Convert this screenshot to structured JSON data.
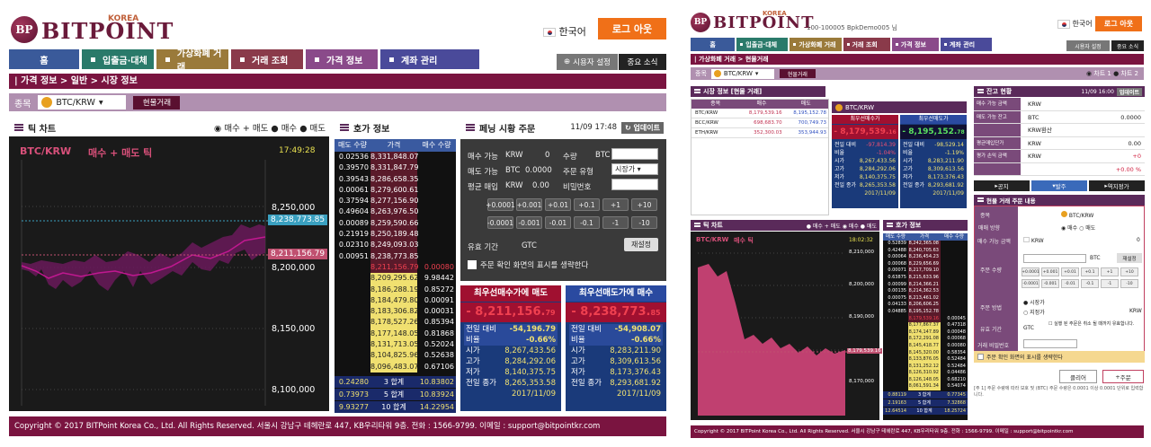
{
  "brand": {
    "name": "BITPOINT",
    "sub": "KOREA",
    "mark": "BP"
  },
  "left": {
    "lang": "한국어",
    "logout": "로그 아웃",
    "menus": [
      "홈",
      "입출금·대체",
      "가상화폐 거래",
      "거래 조회",
      "가격 정보",
      "계좌 관리"
    ],
    "prefs": "시용자 설정",
    "notice": "중요 소식",
    "breadcrumb": "가격 정보  >  일반  >  시장 정보",
    "symbol_label": "종목",
    "symbol": "BTC/KRW",
    "spot_btn": "현물거래",
    "tick": {
      "title": "틱 차트",
      "radios": [
        "매수 + 매도",
        "매수",
        "매도"
      ],
      "pair": "BTC/KRW",
      "mode": "매수 + 매도 틱",
      "time": "17:49:28",
      "axis": [
        "8,250,000",
        "8,200,000",
        "8,150,000",
        "8,100,000"
      ],
      "ask_tag": "8,238,773.85",
      "bid_tag": "8,211,156.79"
    },
    "orderbook": {
      "title": "호가 정보",
      "headers": [
        "매도 수량",
        "가격",
        "매수 수량"
      ],
      "asks": [
        [
          "0.02536",
          "8,331,848.07"
        ],
        [
          "0.39570",
          "8,331,847.79"
        ],
        [
          "0.39543",
          "8,286,658.35"
        ],
        [
          "0.00061",
          "8,279,600.61"
        ],
        [
          "0.37594",
          "8,277,156.90"
        ],
        [
          "0.49604",
          "8,263,976.50"
        ],
        [
          "0.00089",
          "8,259,590.66"
        ],
        [
          "0.21919",
          "8,250,189.48"
        ],
        [
          "0.02310",
          "8,249,093.03"
        ],
        [
          "0.00951",
          "8,238,773.85"
        ]
      ],
      "bids": [
        [
          "8,211,156.79",
          "0.00080"
        ],
        [
          "8,209,295.62",
          "9.98442"
        ],
        [
          "8,186,288.19",
          "0.85272"
        ],
        [
          "8,184,479.80",
          "0.00091"
        ],
        [
          "8,183,306.82",
          "0.00031"
        ],
        [
          "8,178,527.26",
          "0.85394"
        ],
        [
          "8,177,148.05",
          "0.81868"
        ],
        [
          "8,131,713.05",
          "0.52024"
        ],
        [
          "8,104,825.96",
          "0.52638"
        ],
        [
          "8,096,483.07",
          "0.67106"
        ]
      ],
      "totals": [
        [
          "0.24280",
          "3 합계",
          "10.83802"
        ],
        [
          "0.73973",
          "5 합계",
          "10.83924"
        ],
        [
          "9.93277",
          "10 합계",
          "14.22954"
        ]
      ]
    },
    "order": {
      "title": "페닝 시황 주문",
      "time": "11/09 17:48",
      "update": "업데이트",
      "avail_krw_l": "매수 가능",
      "avail_krw_c": "KRW",
      "avail_krw_v": "0",
      "avail_btc_l": "매도 가능",
      "avail_btc_c": "BTC",
      "avail_btc_v": "0.0000",
      "avg_l": "평균 매입",
      "avg_c": "KRW",
      "avg_v": "0.00",
      "qty_l": "수량",
      "qty_c": "BTC",
      "type_l": "주문 유형",
      "type_v": "시장가",
      "pw_l": "비밀번호",
      "steps1": [
        "+0.0001",
        "+0.001",
        "+0.01",
        "+0.1",
        "+1",
        "+10"
      ],
      "steps2": [
        "-0.0001",
        "-0.001",
        "-0.01",
        "-0.1",
        "-1",
        "-10"
      ],
      "valid_l": "유효 기간",
      "valid_v": "GTC",
      "reset": "재설정",
      "skip": "주문 확인 화면의 표시를 생략한다"
    },
    "best_bid": {
      "title": "최우선매수가에 매도",
      "price": "- 8,211,156.",
      "frac": "79",
      "cmp_l": "전일 대비",
      "cmp_v": "-54,196.79",
      "rate_l": "비율",
      "rate_v": "-0.66%",
      "rows": [
        [
          "시가",
          "8,267,433.56"
        ],
        [
          "고가",
          "8,284,292.06"
        ],
        [
          "저가",
          "8,140,375.75"
        ],
        [
          "전일 종가",
          "8,265,353.58"
        ]
      ],
      "date": "2017/11/09"
    },
    "best_ask": {
      "title": "최우선매도가에 매수",
      "price": "- 8,238,773.",
      "frac": "85",
      "cmp_l": "전일 대비",
      "cmp_v": "-54,908.07",
      "rate_l": "비율",
      "rate_v": "-0.66%",
      "rows": [
        [
          "시가",
          "8,283,211.90"
        ],
        [
          "고가",
          "8,309,613.56"
        ],
        [
          "저가",
          "8,173,376.43"
        ],
        [
          "전일 종가",
          "8,293,681.92"
        ]
      ],
      "date": "2017/11/09"
    },
    "footer": "Copyright © 2017 BITPoint Korea Co., Ltd. All Rights Reserved. 서울시 강남구 테헤란로 447, KB우리타워 9층. 전화 : 1566-9799. 이메일 : support@bitpointkr.com"
  },
  "right": {
    "user": "100-100005  BpkDemo005 님",
    "lang": "한국어",
    "logout": "로그 아웃",
    "menus": [
      "홈",
      "입출금·대체",
      "가상화폐 거래",
      "거래 조회",
      "가격 정보",
      "계좌 관리"
    ],
    "prefs": "시용자 설정",
    "notice": "중요 소식",
    "breadcrumb": "가상화폐 거래  >  현물거래",
    "symbol_label": "종목",
    "symbol": "BTC/KRW",
    "spot_btn": "현물거래",
    "radios": [
      "차트 1",
      "차트 2"
    ],
    "market": {
      "title": "시장 정보 [현물 거래]",
      "headers": [
        "종목",
        "매수",
        "매도"
      ],
      "rows": [
        [
          "BTC/KRW",
          "8,179,539.16",
          "8,195,152.78"
        ],
        [
          "BCC/KRW",
          "698,683.70",
          "700,749.73"
        ],
        [
          "ETH/KRW",
          "352,300.03",
          "353,944.93"
        ]
      ]
    },
    "quote": {
      "sym": "BTC/KRW",
      "bid_l": "최우선매수가",
      "ask_l": "최우선매도가",
      "bid": "- 8,179,539.",
      "bid_f": "16",
      "ask": "- 8,195,152.",
      "ask_f": "78",
      "cmp_l": "전일 대비",
      "bcmp": "-97,814.39",
      "acmp": "-98,529.14",
      "rate_l": "비율",
      "brate": "-1.04%",
      "arate": "-1.19%",
      "rows": [
        [
          "시가",
          "8,267,433.56",
          "8,283,211.90"
        ],
        [
          "고가",
          "8,284,292.06",
          "8,309,613.56"
        ],
        [
          "저가",
          "8,140,375.75",
          "8,173,376.43"
        ],
        [
          "전일 종가",
          "8,265,353.58",
          "8,293,681.92"
        ]
      ],
      "date": "2017/11/09"
    },
    "balance": {
      "title": "잔고 현황",
      "time": "11/09 16:00",
      "update": "업데이트",
      "rows": [
        [
          "매수 가능 금액",
          "KRW",
          ""
        ],
        [
          "매도 가능 잔고",
          "BTC",
          "0.0000"
        ],
        [
          "",
          "KRW환산",
          ""
        ],
        [
          "평균매입단가",
          "KRW",
          "0.00"
        ],
        [
          "평가 손익 금액",
          "KRW",
          "+0"
        ],
        [
          "",
          "",
          "+0.00 %"
        ]
      ]
    },
    "tabs": [
      "공지",
      "발주",
      "역지정가"
    ],
    "form": {
      "title": "현물 거래 주문 내용",
      "sym_l": "종목",
      "sym": "BTC/KRW",
      "side_l": "매매 방향",
      "buy": "매수",
      "sell": "매도",
      "avail_l": "매수 가능 금액",
      "avail_c": "KRW",
      "avail_v": "0",
      "qty_l": "주문 수량",
      "qty_c": "BTC",
      "reset": "재설정",
      "steps1": [
        "+0.0001",
        "+0.001",
        "+0.01",
        "+0.1",
        "+1",
        "+10"
      ],
      "steps2": [
        "-0.0001",
        "-0.001",
        "-0.01",
        "-0.1",
        "-1",
        "-10"
      ],
      "type_l": "주문 방법",
      "market": "시장가",
      "limit": "지정가",
      "limit_c": "KRW",
      "valid_l": "유효 기간",
      "valid_v": "GTC",
      "valid_note": "실행 된 주문은 취소 될 때까지 유효합니다.",
      "pw_l": "거래 비밀번호",
      "skip": "주문 확인 화면의 표시를 생략한다",
      "clear": "클리어",
      "submit": "주문",
      "note": "[주 1] 주문 수량에 따라 보호 및 (BTC) 주문 수량은 0.0001 이상 0.0001 단위로 입력합니다."
    },
    "tick": {
      "title": "틱 차트",
      "radios": [
        "매수 + 매도",
        "매수",
        "매도"
      ],
      "pair": "BTC/KRW",
      "mode": "매수 틱",
      "time": "18:02:32",
      "axis": [
        "8,210,000",
        "8,200,000",
        "8,190,000",
        "8,180,000",
        "8,170,000"
      ],
      "tag": "8,179,539.16"
    },
    "ob": {
      "title": "호가 정보",
      "headers": [
        "매도 수량",
        "가격",
        "매수 수량"
      ],
      "asks": [
        [
          "0.52839",
          "8,242,365.08"
        ],
        [
          "0.42488",
          "8,240,705.63"
        ],
        [
          "0.00064",
          "8,236,454.23"
        ],
        [
          "0.00068",
          "8,229,656.69"
        ],
        [
          "0.00071",
          "8,217,709.10"
        ],
        [
          "0.63875",
          "8,215,633.96"
        ],
        [
          "0.00099",
          "8,214,366.21"
        ],
        [
          "0.00135",
          "8,214,362.53"
        ],
        [
          "0.00075",
          "8,213,461.02"
        ],
        [
          "0.04133",
          "8,206,606.25"
        ],
        [
          "0.04885",
          "8,195,152.78"
        ]
      ],
      "bids": [
        [
          "8,179,539.16",
          "0.00045"
        ],
        [
          "8,177,867.37",
          "0.47318"
        ],
        [
          "8,174,147.89",
          "0.00048"
        ],
        [
          "8,172,291.08",
          "0.00068"
        ],
        [
          "8,145,418.77",
          "0.00080"
        ],
        [
          "8,145,320.00",
          "0.58354"
        ],
        [
          "8,133,876.05",
          "0.52484"
        ],
        [
          "8,131,252.12",
          "0.52484"
        ],
        [
          "8,126,310.92",
          "0.04486"
        ],
        [
          "8,126,148.05",
          "0.68210"
        ],
        [
          "8,061,591.34",
          "0.54074"
        ]
      ],
      "totals": [
        [
          "0.88119",
          "3 합계",
          "0.77345"
        ],
        [
          "2.19163",
          "5 합계",
          "7.32868"
        ],
        [
          "12.64514",
          "10 합계",
          "18.25724"
        ]
      ]
    },
    "footer": "Copyright © 2017 BITPoint Korea Co., Ltd. All Rights Reserved. 서울시 강남구 테헤란로 447, KB우리타워 9층. 전화 : 1566-9799. 이메일 : support@bitpointkr.com"
  }
}
